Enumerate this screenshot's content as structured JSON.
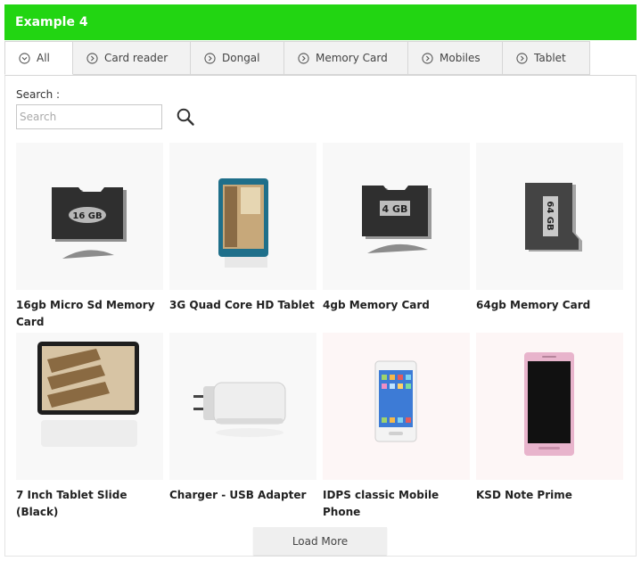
{
  "header": {
    "title": "Example 4"
  },
  "tabs": [
    {
      "label": "All",
      "icon": "chevron-circle-down-icon"
    },
    {
      "label": "Card reader",
      "icon": "chevron-circle-right-icon"
    },
    {
      "label": "Dongal",
      "icon": "chevron-circle-right-icon"
    },
    {
      "label": "Memory Card",
      "icon": "chevron-circle-right-icon"
    },
    {
      "label": "Mobiles",
      "icon": "chevron-circle-right-icon"
    },
    {
      "label": "Tablet",
      "icon": "chevron-circle-right-icon"
    }
  ],
  "search": {
    "label": "Search :",
    "placeholder": "Search",
    "value": "",
    "icon": "search-icon"
  },
  "products": [
    {
      "name": "16gb Micro Sd Memory Card",
      "image": "memory-card-icon",
      "image_text": "16 GB"
    },
    {
      "name": "3G Quad Core HD Tablet",
      "image": "tablet-icon"
    },
    {
      "name": "4gb Memory Card",
      "image": "memory-card-icon",
      "image_text": "4 GB"
    },
    {
      "name": "64gb Memory Card",
      "image": "memory-card-icon",
      "image_text": "64 GB"
    },
    {
      "name": "7 Inch Tablet Slide (Black)",
      "image": "tablet-icon"
    },
    {
      "name": "Charger - USB Adapter",
      "image": "charger-icon"
    },
    {
      "name": "IDPS classic Mobile Phone",
      "image": "mobile-phone-icon"
    },
    {
      "name": "KSD Note Prime",
      "image": "mobile-phone-icon"
    }
  ],
  "load_more": {
    "label": "Load More"
  },
  "colors": {
    "header_bg": "#22d512",
    "tab_bg": "#f2f2f2"
  }
}
